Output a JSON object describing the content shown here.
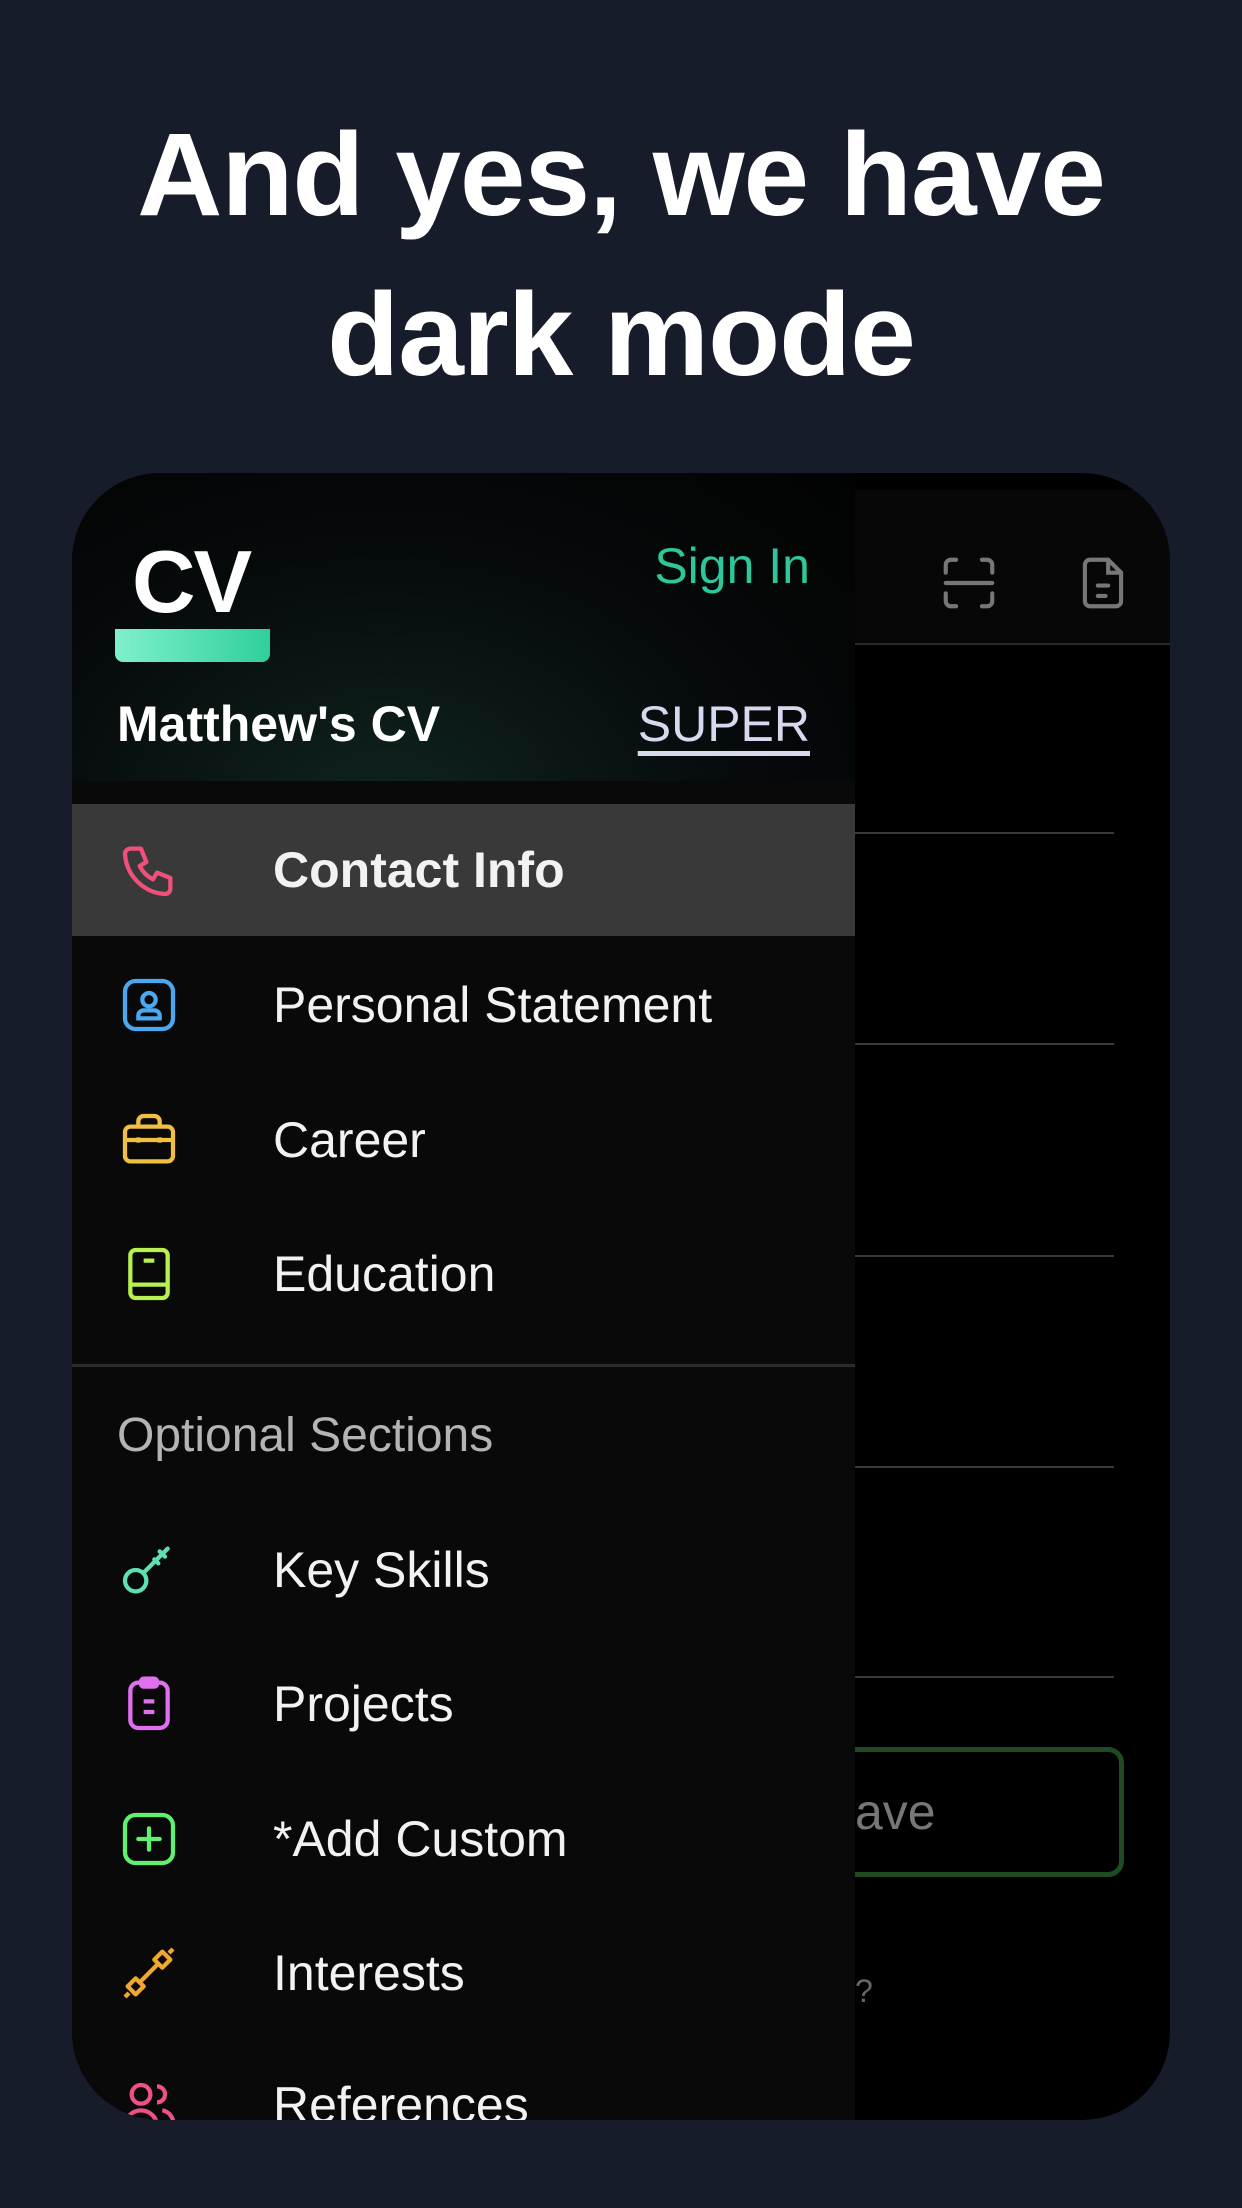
{
  "headline": {
    "line1": "And yes, we have",
    "line2": "dark mode"
  },
  "drawer": {
    "logo": "CV",
    "sign_in": "Sign In",
    "cv_name": "Matthew's CV",
    "plan_badge": "SUPER",
    "main_items": [
      {
        "label": "Contact Info",
        "icon": "phone-icon",
        "color": "#f0507a",
        "active": true
      },
      {
        "label": "Personal Statement",
        "icon": "user-badge-icon",
        "color": "#4aa8f0"
      },
      {
        "label": "Career",
        "icon": "briefcase-icon",
        "color": "#f0c040"
      },
      {
        "label": "Education",
        "icon": "book-icon",
        "color": "#b8f050"
      }
    ],
    "optional_heading": "Optional Sections",
    "optional_items": [
      {
        "label": "Key Skills",
        "icon": "key-icon",
        "color": "#5ee0b0"
      },
      {
        "label": "Projects",
        "icon": "clipboard-icon",
        "color": "#e070f0"
      },
      {
        "label": "*Add Custom",
        "icon": "plus-square-icon",
        "color": "#60f070"
      },
      {
        "label": "Interests",
        "icon": "dumbbell-icon",
        "color": "#f0a830"
      },
      {
        "label": "References",
        "icon": "users-icon",
        "color": "#f0508a"
      }
    ]
  },
  "main": {
    "save_partial": "ave",
    "help_partial": "?"
  },
  "colors": {
    "background": "#171c2a",
    "accent": "#2ec79c"
  }
}
